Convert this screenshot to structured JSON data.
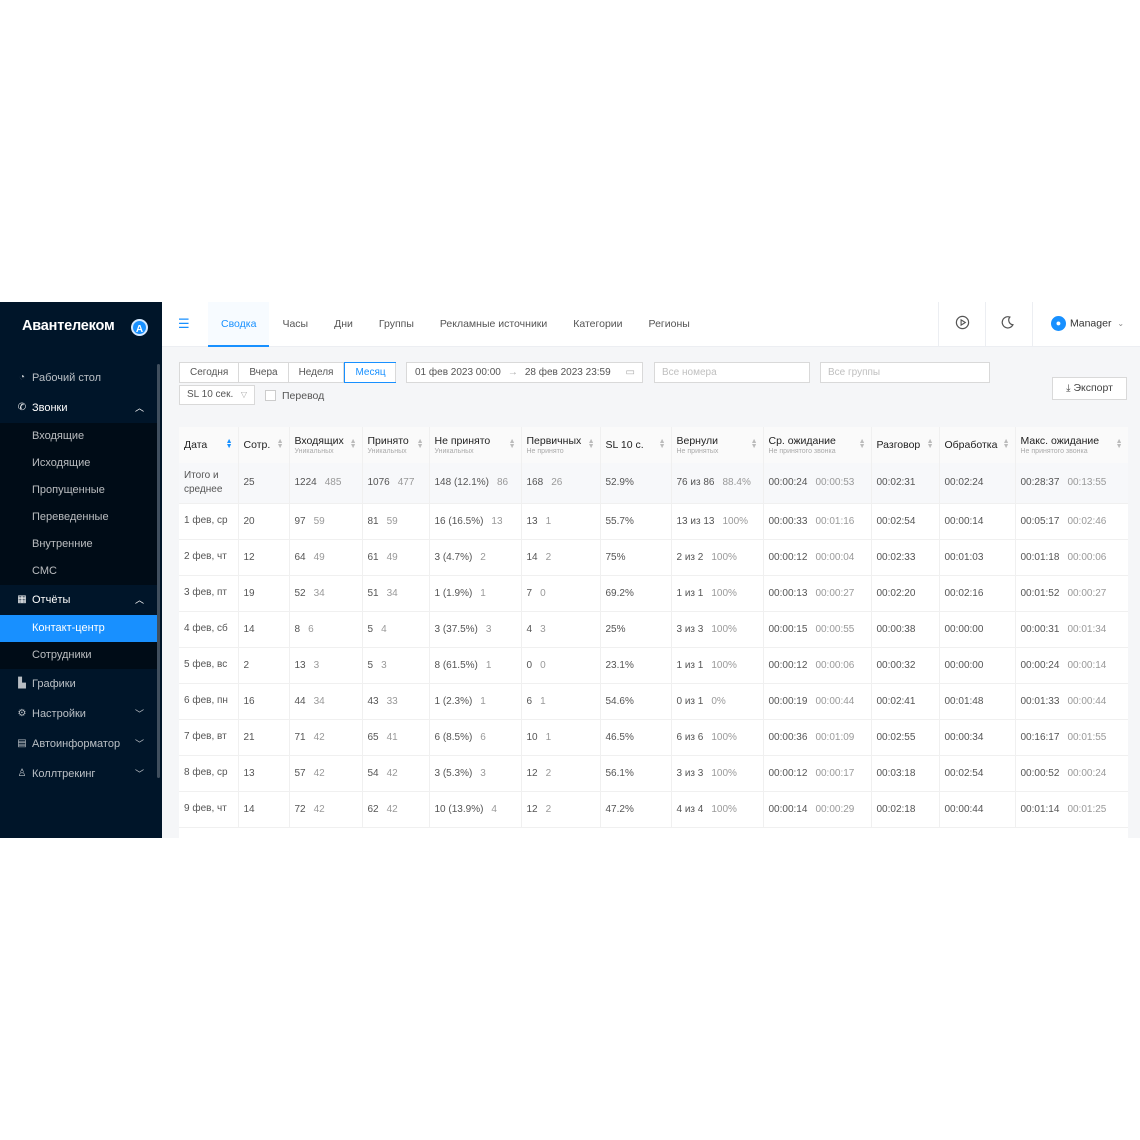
{
  "app": {
    "brand": "Авантелеком",
    "brand_badge": "A"
  },
  "sidebar": {
    "items": [
      {
        "label": "Рабочий стол",
        "icon": "dashboard-icon"
      },
      {
        "label": "Звонки",
        "icon": "phone-icon",
        "open": true,
        "children": [
          "Входящие",
          "Исходящие",
          "Пропущенные",
          "Переведенные",
          "Внутренние",
          "СМС"
        ]
      },
      {
        "label": "Отчёты",
        "icon": "table-icon",
        "open": true,
        "children": [
          "Контакт-центр",
          "Сотрудники"
        ],
        "active_child": "Контакт-центр"
      },
      {
        "label": "Графики",
        "icon": "chart-icon"
      },
      {
        "label": "Настройки",
        "icon": "gear-icon"
      },
      {
        "label": "Автоинформатор",
        "icon": "document-icon"
      },
      {
        "label": "Коллтрекинг",
        "icon": "user-icon"
      }
    ]
  },
  "topbar": {
    "tabs": [
      "Сводка",
      "Часы",
      "Дни",
      "Группы",
      "Рекламные источники",
      "Категории",
      "Регионы"
    ],
    "active_tab": "Сводка",
    "user": "Manager"
  },
  "filters": {
    "periods": [
      "Сегодня",
      "Вчера",
      "Неделя",
      "Месяц"
    ],
    "active_period": "Месяц",
    "date_from": "01 фев 2023 00:00",
    "date_to": "28 фев 2023 23:59",
    "numbers_placeholder": "Все номера",
    "groups_placeholder": "Все группы",
    "sl_select": "SL 10 сек.",
    "transfer_label": "Перевод",
    "export_label": "Экспорт"
  },
  "table": {
    "headers": [
      {
        "title": "Дата",
        "sub": "",
        "sort": "asc"
      },
      {
        "title": "Сотр.",
        "sub": ""
      },
      {
        "title": "Входящих",
        "sub": "Уникальных"
      },
      {
        "title": "Принято",
        "sub": "Уникальных"
      },
      {
        "title": "Не принято",
        "sub": "Уникальных"
      },
      {
        "title": "Первичных",
        "sub": "Не принято"
      },
      {
        "title": "SL 10 с.",
        "sub": ""
      },
      {
        "title": "Вернули",
        "sub": "Не принятых"
      },
      {
        "title": "Ср. ожидание",
        "sub": "Не принятого звонка"
      },
      {
        "title": "Разговор",
        "sub": ""
      },
      {
        "title": "Обработка",
        "sub": ""
      },
      {
        "title": "Макс. ожидание",
        "sub": "Не принятого звонка"
      }
    ],
    "total": [
      "Итого и среднее",
      "25",
      "1224|485",
      "1076|477",
      "148 (12.1%)|86",
      "168|26",
      "52.9%",
      "76 из 86|88.4%",
      "00:00:24|00:00:53",
      "00:02:31",
      "00:02:24",
      "00:28:37|00:13:55"
    ],
    "rows": [
      [
        "1 фев, ср",
        "20",
        "97|59",
        "81|59",
        "16 (16.5%)|13",
        "13|1",
        "55.7%",
        "13 из 13|100%",
        "00:00:33|00:01:16",
        "00:02:54",
        "00:00:14",
        "00:05:17|00:02:46"
      ],
      [
        "2 фев, чт",
        "12",
        "64|49",
        "61|49",
        "3 (4.7%)|2",
        "14|2",
        "75%",
        "2 из 2|100%",
        "00:00:12|00:00:04",
        "00:02:33",
        "00:01:03",
        "00:01:18|00:00:06"
      ],
      [
        "3 фев, пт",
        "19",
        "52|34",
        "51|34",
        "1 (1.9%)|1",
        "7|0",
        "69.2%",
        "1 из 1|100%",
        "00:00:13|00:00:27",
        "00:02:20",
        "00:02:16",
        "00:01:52|00:00:27"
      ],
      [
        "4 фев, сб",
        "14",
        "8|6",
        "5|4",
        "3 (37.5%)|3",
        "4|3",
        "25%",
        "3 из 3|100%",
        "00:00:15|00:00:55",
        "00:00:38",
        "00:00:00",
        "00:00:31|00:01:34"
      ],
      [
        "5 фев, вс",
        "2",
        "13|3",
        "5|3",
        "8 (61.5%)|1",
        "0|0",
        "23.1%",
        "1 из 1|100%",
        "00:00:12|00:00:06",
        "00:00:32",
        "00:00:00",
        "00:00:24|00:00:14"
      ],
      [
        "6 фев, пн",
        "16",
        "44|34",
        "43|33",
        "1 (2.3%)|1",
        "6|1",
        "54.6%",
        "0 из 1|0%",
        "00:00:19|00:00:44",
        "00:02:41",
        "00:01:48",
        "00:01:33|00:00:44"
      ],
      [
        "7 фев, вт",
        "21",
        "71|42",
        "65|41",
        "6 (8.5%)|6",
        "10|1",
        "46.5%",
        "6 из 6|100%",
        "00:00:36|00:01:09",
        "00:02:55",
        "00:00:34",
        "00:16:17|00:01:55"
      ],
      [
        "8 фев, ср",
        "13",
        "57|42",
        "54|42",
        "3 (5.3%)|3",
        "12|2",
        "56.1%",
        "3 из 3|100%",
        "00:00:12|00:00:17",
        "00:03:18",
        "00:02:54",
        "00:00:52|00:00:24"
      ],
      [
        "9 фев, чт",
        "14",
        "72|42",
        "62|42",
        "10 (13.9%)|4",
        "12|2",
        "47.2%",
        "4 из 4|100%",
        "00:00:14|00:00:29",
        "00:02:18",
        "00:00:44",
        "00:01:14|00:01:25"
      ]
    ]
  }
}
